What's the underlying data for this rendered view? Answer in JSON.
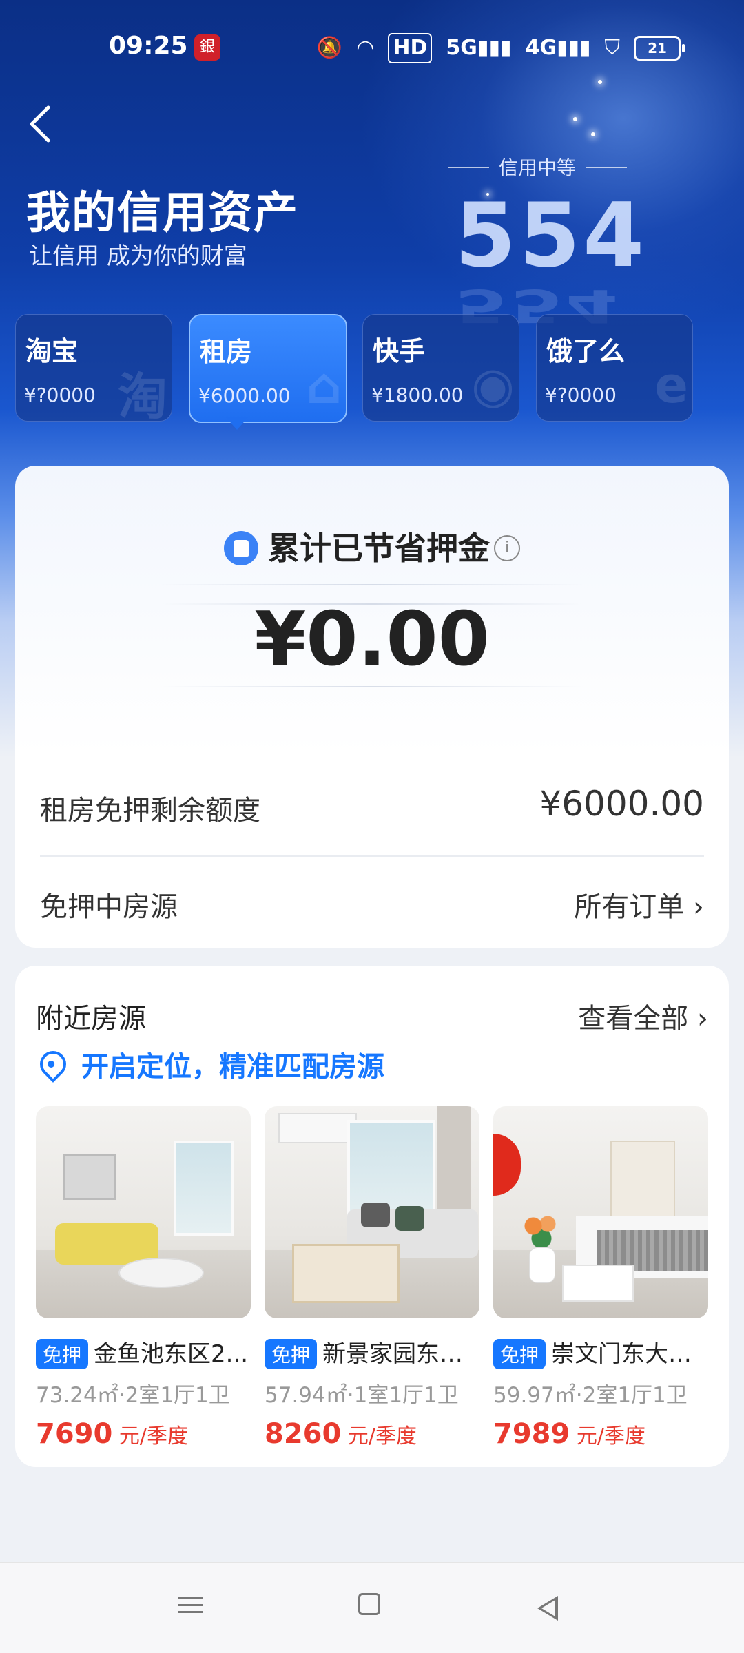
{
  "status_bar": {
    "time": "09:25",
    "battery": "21",
    "hd_label": "HD",
    "net_5g": "5G",
    "net_4g": "4G"
  },
  "header": {
    "title": "我的信用资产",
    "subtitle": "让信用 成为你的财富",
    "credit_level": "信用中等",
    "score": "554"
  },
  "platform_tabs": [
    {
      "name": "淘宝",
      "amount": "¥?0000",
      "watermark": "淘"
    },
    {
      "name": "租房",
      "amount": "¥6000.00",
      "watermark": "⌂"
    },
    {
      "name": "快手",
      "amount": "¥1800.00",
      "watermark": "◉"
    },
    {
      "name": "饿了么",
      "amount": "¥?0000",
      "watermark": "e"
    }
  ],
  "savings_card": {
    "title": "累计已节省押金",
    "amount": "¥0.00",
    "remaining_label": "租房免押剩余额度",
    "remaining_value": "¥6000.00",
    "listing_label": "免押中房源",
    "all_orders": "所有订单 ›"
  },
  "nearby": {
    "title": "附近房源",
    "view_all": "查看全部 ›",
    "locate_text": "开启定位，精准匹配房源",
    "badge": "免押",
    "price_unit": "元/季度",
    "listings": [
      {
        "title": "金鱼池东区2...",
        "info": "73.24㎡·2室1厅1卫",
        "price": "7690"
      },
      {
        "title": "新景家园东区...",
        "info": "57.94㎡·1室1厅1卫",
        "price": "8260"
      },
      {
        "title": "崇文门东大街...",
        "info": "59.97㎡·2室1厅1卫",
        "price": "7989"
      }
    ]
  },
  "colors": {
    "accent": "#1677ff",
    "price_red": "#e83a2e",
    "hero_blue": "#0f3ea8"
  }
}
